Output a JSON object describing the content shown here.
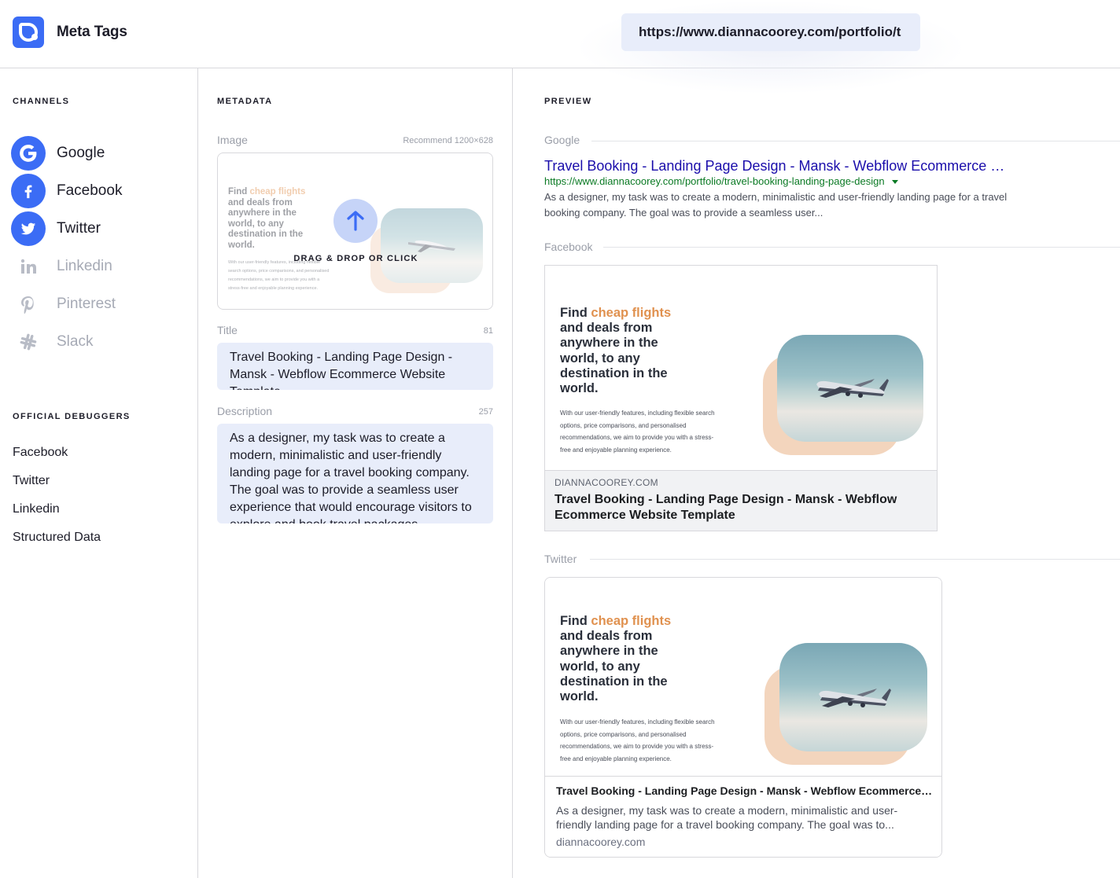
{
  "header": {
    "brand": "Meta Tags",
    "url_value": "https://www.diannacoorey.com/portfolio/t"
  },
  "channels": {
    "title": "CHANNELS",
    "items": [
      {
        "label": "Google",
        "icon": "google-icon",
        "active": true
      },
      {
        "label": "Facebook",
        "icon": "facebook-icon",
        "active": true
      },
      {
        "label": "Twitter",
        "icon": "twitter-icon",
        "active": true
      },
      {
        "label": "Linkedin",
        "icon": "linkedin-icon",
        "active": false
      },
      {
        "label": "Pinterest",
        "icon": "pinterest-icon",
        "active": false
      },
      {
        "label": "Slack",
        "icon": "slack-icon",
        "active": false
      }
    ]
  },
  "debuggers": {
    "title": "OFFICIAL DEBUGGERS",
    "items": [
      "Facebook",
      "Twitter",
      "Linkedin",
      "Structured Data"
    ]
  },
  "metadata": {
    "title": "METADATA",
    "image_label": "Image",
    "image_hint": "Recommend 1200×628",
    "drop_text": "DRAG & DROP OR CLICK",
    "title_label": "Title",
    "title_count": "81",
    "title_value": "Travel Booking - Landing Page Design - Mansk - Webflow Ecommerce Website Template",
    "description_label": "Description",
    "description_count": "257",
    "description_value": "As a designer, my task was to create a modern, minimalistic and user-friendly landing page for a travel booking company. The goal was to provide a seamless user experience that would encourage visitors to explore and book travel packages."
  },
  "artwork": {
    "headline_pre": "Find ",
    "headline_highlight": "cheap flights",
    "headline_rest": "and deals from anywhere in the world, to any destination in the world.",
    "small_text": "With our user-friendly features, including flexible search options, price comparisons, and personalised recommendations, we aim to provide you with a stress-free and enjoyable planning experience."
  },
  "preview": {
    "title": "PREVIEW",
    "google": {
      "label": "Google",
      "title": "Travel Booking - Landing Page Design - Mansk - Webflow Ecommerce …",
      "url": "https://www.diannacoorey.com/portfolio/travel-booking-landing-page-design",
      "description": "As a designer, my task was to create a modern, minimalistic and user-friendly landing page for a travel booking company. The goal was to provide a seamless user..."
    },
    "facebook": {
      "label": "Facebook",
      "domain": "DIANNACOOREY.COM",
      "title": "Travel Booking - Landing Page Design - Mansk - Webflow Ecommerce Website Template"
    },
    "twitter": {
      "label": "Twitter",
      "title": "Travel Booking - Landing Page Design - Mansk - Webflow Ecommerce Website Template",
      "description": "As a designer, my task was to create a modern, minimalistic and user-friendly landing page for a travel booking company. The goal was to...",
      "domain": "diannacoorey.com"
    }
  },
  "colors": {
    "accent": "#3b6cf5",
    "field_bg": "#e8edfa",
    "google_link": "#1a0dab",
    "google_url": "#0b7a24",
    "highlight": "#e0914f"
  }
}
